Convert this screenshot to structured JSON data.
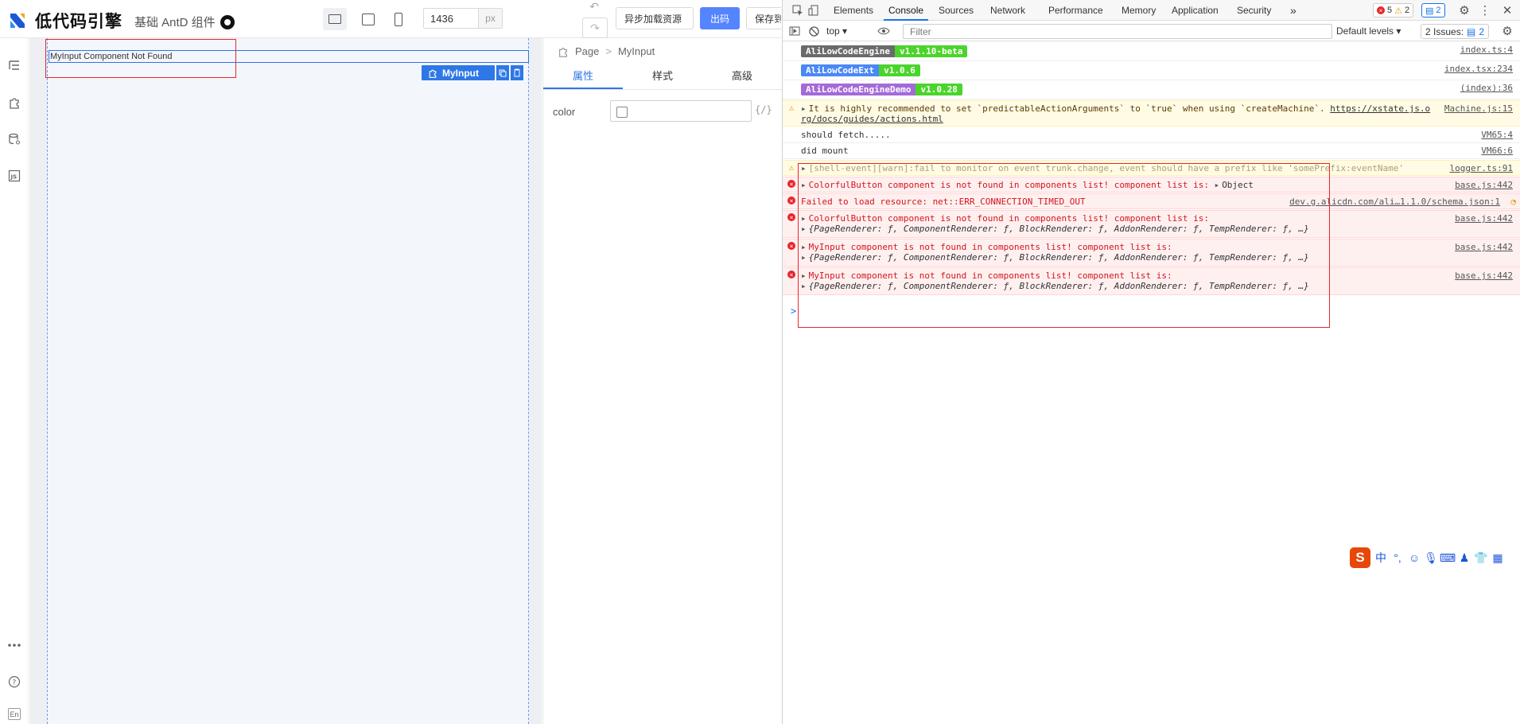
{
  "app": {
    "logo_text": "低代码引擎",
    "subtitle": "基础 AntD 组件",
    "width_value": "1436",
    "width_unit": "px",
    "undo": "↶",
    "redo": "↷",
    "buttons": {
      "async": "异步加载资源",
      "export": "出码",
      "save": "保存到本地"
    },
    "canvas": {
      "not_found": "MyInput Component Not Found",
      "selected_component": "MyInput"
    },
    "settings": {
      "breadcrumb": [
        "Page",
        "MyInput"
      ],
      "tabs": [
        "属性",
        "样式",
        "高级"
      ],
      "prop_label": "color",
      "var_hint": "{/}"
    },
    "leftbar_bottom": {
      "lang": "En"
    }
  },
  "devtools": {
    "tabs": [
      "Elements",
      "Console",
      "Sources",
      "Network",
      "Performance",
      "Memory",
      "Application",
      "Security"
    ],
    "active_tab": "Console",
    "more": "»",
    "errors_count": "5",
    "warnings_count": "2",
    "messages_count": "2",
    "context": "top",
    "filter_placeholder": "Filter",
    "levels": "Default levels",
    "issues_label": "2 Issues:",
    "issues_count": "2",
    "prompt": ">"
  },
  "console": {
    "badges": [
      {
        "name": "AliLowCodeEngine",
        "version": "v1.1.10-beta",
        "color": "#6b6b6b",
        "src": "index.ts:4"
      },
      {
        "name": "AliLowCodeExt",
        "version": "v1.0.6",
        "color": "#4a88f5",
        "src": "index.tsx:234"
      },
      {
        "name": "AliLowCodeEngineDemo",
        "version": "v1.0.28",
        "color": "#a46ad8",
        "src": "(index):36"
      }
    ],
    "xstate_warn": {
      "line1": "It is highly recommended to set `predictableActionArguments` to `true` when using `createMachine`. ",
      "link1": "https://xstate.js.o",
      "line2": "rg/docs/guides/actions.html",
      "src": "Machine.js:15"
    },
    "logs": [
      {
        "text": "should fetch.....",
        "src": "VM65:4"
      },
      {
        "text": "did mount",
        "src": "VM66:6"
      }
    ],
    "shell_warn": {
      "text": "[shell-event][warn]:fail to monitor on event trunk.change, event should have a prefix like 'somePrefix:eventName'",
      "src": "logger.ts:91"
    },
    "errors": [
      {
        "text": "ColorfulButton component is not found in components list! component list is: ",
        "tail": "Object",
        "src": "base.js:442"
      },
      {
        "text": "Failed to load resource: net::ERR_CONNECTION_TIMED_OUT",
        "src": "dev.g.alicdn.com/ali…1.1.0/schema.json:1"
      },
      {
        "text": "ColorfulButton component is not found in components list! component list is:",
        "detail": "{PageRenderer: ƒ, ComponentRenderer: ƒ, BlockRenderer: ƒ, AddonRenderer: ƒ, TempRenderer: ƒ, …}",
        "src": "base.js:442"
      },
      {
        "text": "MyInput component is not found in components list! component list is:",
        "detail": "{PageRenderer: ƒ, ComponentRenderer: ƒ, BlockRenderer: ƒ, AddonRenderer: ƒ, TempRenderer: ƒ, …}",
        "src": "base.js:442"
      },
      {
        "text": "MyInput component is not found in components list! component list is:",
        "detail": "{PageRenderer: ƒ, ComponentRenderer: ƒ, BlockRenderer: ƒ, AddonRenderer: ƒ, TempRenderer: ƒ, …}",
        "src": "base.js:442"
      }
    ]
  },
  "ime": {
    "logo": "S",
    "lang": "中",
    "punct": "°,"
  }
}
